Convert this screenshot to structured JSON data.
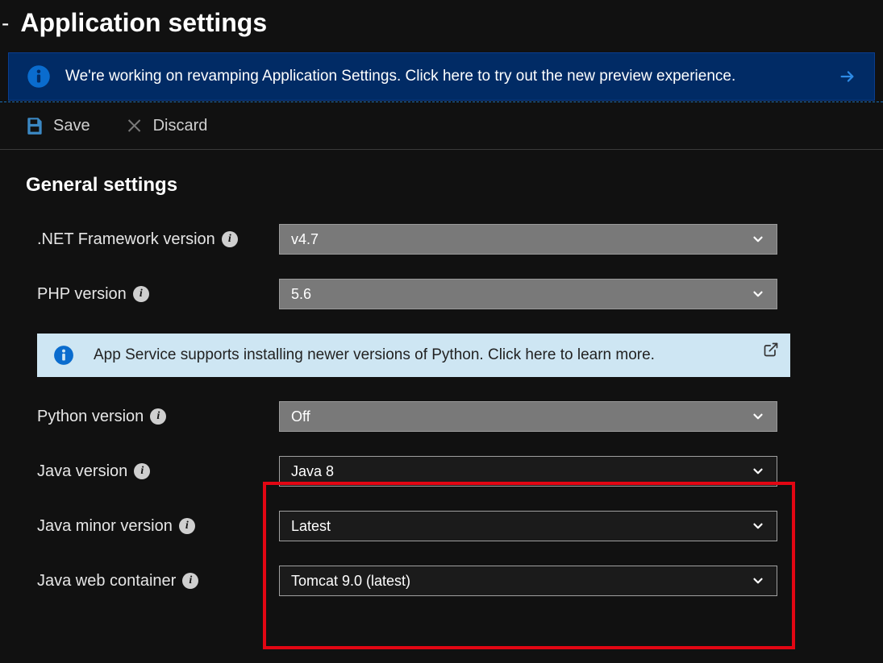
{
  "page": {
    "title": "Application settings"
  },
  "banner": {
    "text": "We're working on revamping Application Settings. Click here to try out the new preview experience."
  },
  "toolbar": {
    "save_label": "Save",
    "discard_label": "Discard"
  },
  "section": {
    "heading": "General settings"
  },
  "python_banner": {
    "text": "App Service supports installing newer versions of Python. Click here to learn more."
  },
  "fields": {
    "dotnet": {
      "label": ".NET Framework version",
      "value": "v4.7"
    },
    "php": {
      "label": "PHP version",
      "value": "5.6"
    },
    "python": {
      "label": "Python version",
      "value": "Off"
    },
    "java": {
      "label": "Java version",
      "value": "Java 8"
    },
    "java_minor": {
      "label": "Java minor version",
      "value": "Latest"
    },
    "java_web": {
      "label": "Java web container",
      "value": "Tomcat 9.0 (latest)"
    }
  },
  "colors": {
    "banner_bg": "#012b65",
    "highlight": "#e30613",
    "info_blue": "#0a6cce",
    "python_banner_bg": "#cee6f3"
  }
}
